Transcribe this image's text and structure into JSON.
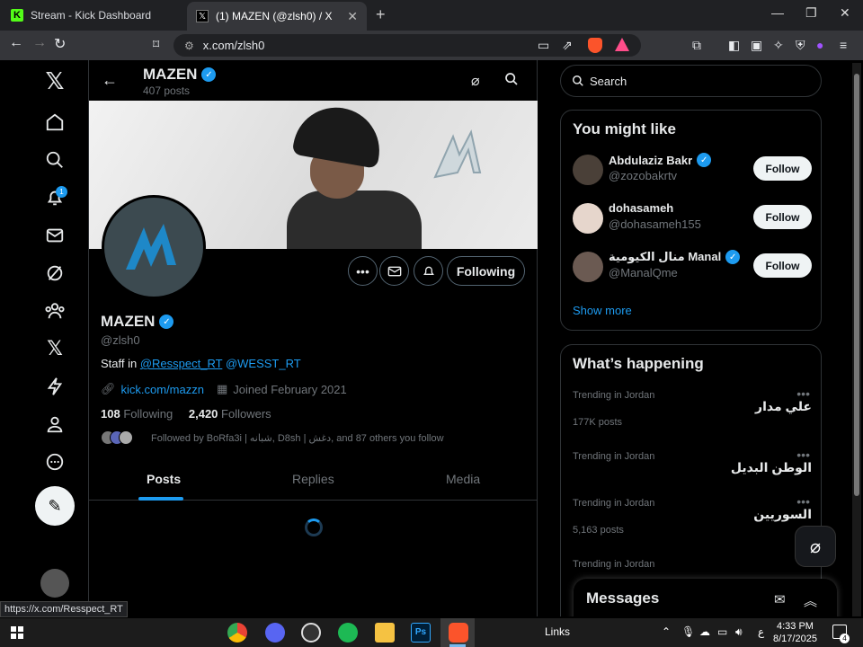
{
  "browser": {
    "tabs": [
      {
        "title": "Stream - Kick Dashboard",
        "favicon": "kick-icon"
      },
      {
        "title": "(1) MAZEN (@zlsh0) / X",
        "favicon": "x-icon"
      }
    ],
    "url": "x.com/zlsh0",
    "status_url": "https://x.com/Resspect_RT"
  },
  "nav": {
    "notification_count": "1",
    "icons": [
      "x-logo-icon",
      "home-icon",
      "search-icon",
      "bell-icon",
      "mail-icon",
      "grok-icon",
      "communities-icon",
      "x-premium-icon",
      "lightning-icon",
      "profile-icon",
      "more-icon"
    ]
  },
  "profile": {
    "name": "MAZEN",
    "posts_count": "407 posts",
    "handle": "@zlsh0",
    "bio_prefix": "Staff in ",
    "bio_link1": "@Resspect_RT",
    "bio_link2": "@WESST_RT",
    "website": "kick.com/mazzn",
    "joined": "Joined February 2021",
    "following_count": "108",
    "following_label": "Following",
    "followers_count": "2,420",
    "followers_label": "Followers",
    "followed_by": "Followed by BoRfa3i | شبانه, D8sh | دغش, and 87 others you follow",
    "following_button": "Following",
    "tabs": [
      "Posts",
      "Replies",
      "Media"
    ]
  },
  "sidebar": {
    "search_placeholder": "Search",
    "you_might_like": {
      "title": "You might like",
      "users": [
        {
          "name": "Abdulaziz Bakr",
          "handle": "@zozobakrtv",
          "verified": true,
          "button": "Follow",
          "avatar_color": "#4a4038"
        },
        {
          "name": "dohasameh",
          "handle": "@dohasameh155",
          "verified": false,
          "button": "Follow",
          "avatar_color": "#e6d6cc"
        },
        {
          "name": "منال الكيومية Manal",
          "handle": "@ManalQme",
          "verified": true,
          "button": "Follow",
          "avatar_color": "#6b5a52"
        }
      ],
      "show_more": "Show more"
    },
    "whats_happening": {
      "title": "What’s happening",
      "trends": [
        {
          "category": "Trending in Jordan",
          "name": "علي مدار",
          "count": "177K posts"
        },
        {
          "category": "Trending in Jordan",
          "name": "الوطن البديل",
          "count": ""
        },
        {
          "category": "Trending in Jordan",
          "name": "السوريين",
          "count": "5,163 posts"
        },
        {
          "category": "Trending in Jordan",
          "name": "",
          "count": ""
        }
      ]
    },
    "messages_title": "Messages"
  },
  "taskbar": {
    "links_label": "Links",
    "time": "4:33 PM",
    "date": "8/17/2025",
    "lang": "ع",
    "notification_count": "4"
  },
  "colors": {
    "accent": "#1d9bf0",
    "background": "#000000",
    "muted": "#71767b"
  }
}
